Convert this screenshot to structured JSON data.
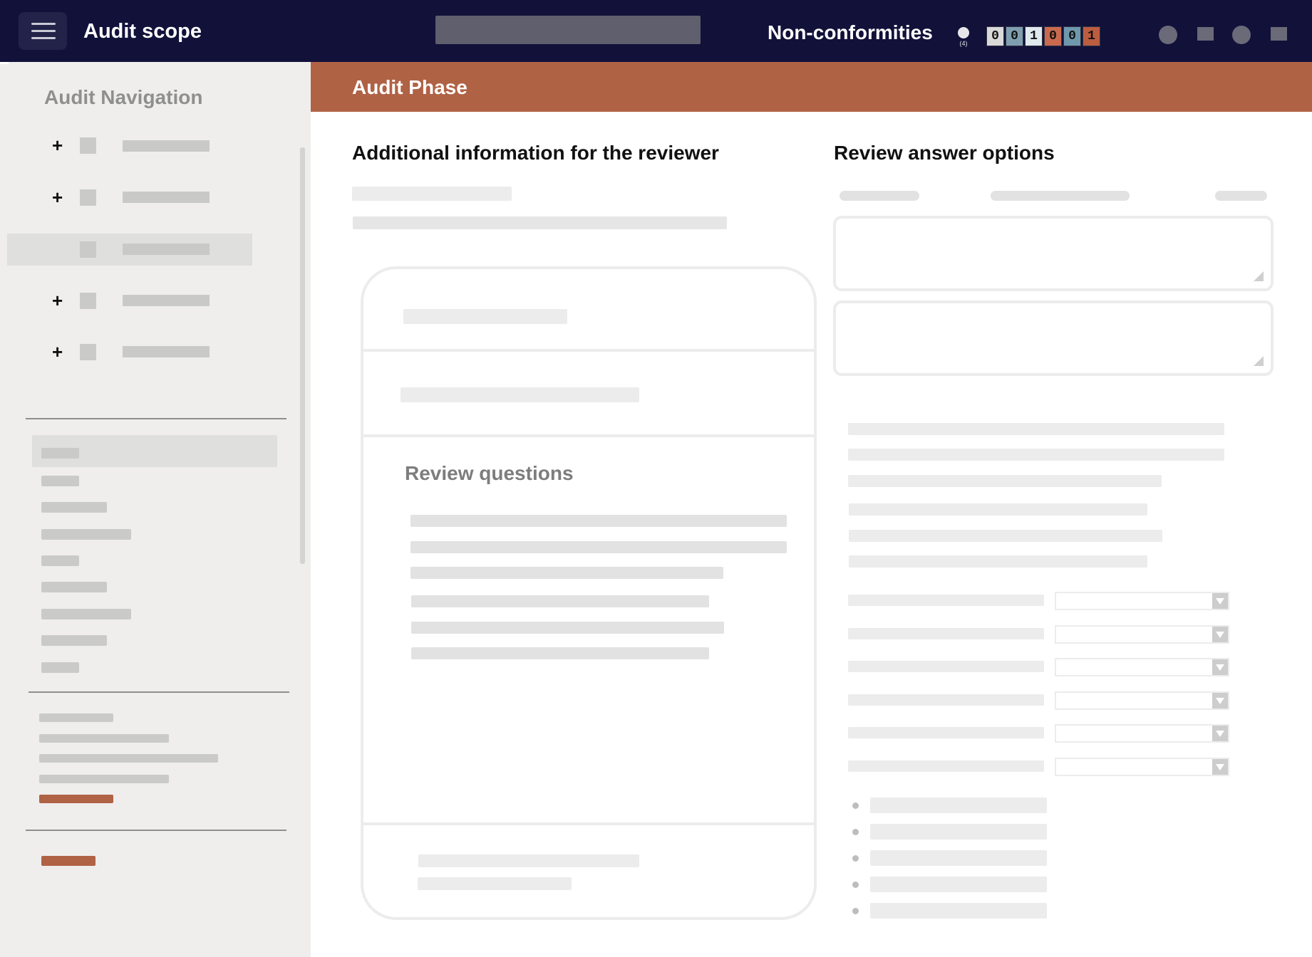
{
  "topbar": {
    "app_title": "Audit scope",
    "nonconformities_label": "Non-conformities",
    "nonconformities_total": "(4)",
    "counters": [
      {
        "value": "0",
        "color": "#d9d9d9"
      },
      {
        "value": "0",
        "color": "#7f9fb1"
      },
      {
        "value": "1",
        "color": "#dfe9ee"
      },
      {
        "value": "0",
        "color": "#c96a4f"
      },
      {
        "value": "0",
        "color": "#6f98ad"
      },
      {
        "value": "1",
        "color": "#bb5d40"
      }
    ],
    "icons": [
      "user-icon",
      "grid-icon",
      "help-icon",
      "logout-icon"
    ]
  },
  "sidebar": {
    "title": "Audit Navigation",
    "tree_items": [
      {
        "expand_symbol": "+",
        "selected": false
      },
      {
        "expand_symbol": "+",
        "selected": false
      },
      {
        "expand_symbol": "",
        "selected": true
      },
      {
        "expand_symbol": "+",
        "selected": false
      },
      {
        "expand_symbol": "+",
        "selected": false
      }
    ]
  },
  "main": {
    "phase_title": "Audit Phase",
    "left_section_title": "Additional information for the reviewer",
    "review_questions_title": "Review questions",
    "right_section_title": "Review answer options"
  },
  "colors": {
    "topbar_bg": "#11113a",
    "accent": "#b06245",
    "sidebar_bg": "#efeeec",
    "placeholder": "#e2e2e2"
  }
}
